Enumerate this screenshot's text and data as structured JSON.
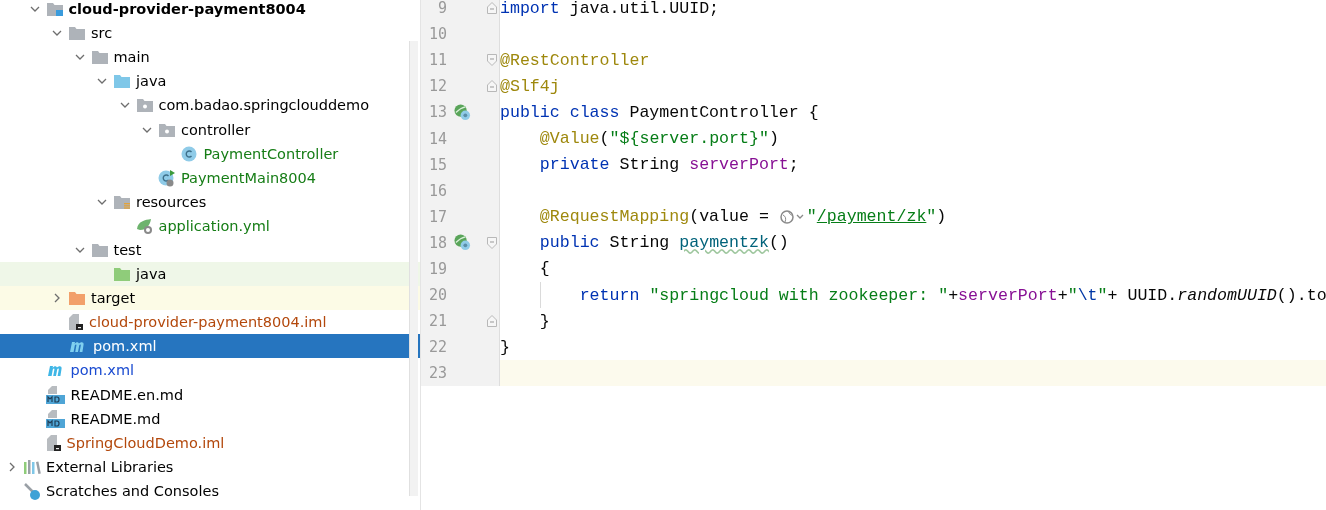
{
  "project_tree": [
    {
      "children": [
        {
          "label": "cloud-provider-payment8004",
          "kind": "module",
          "expanded": true,
          "selected": false,
          "bold": true,
          "children": [
            {
              "label": "src",
              "kind": "folder",
              "expanded": true,
              "selected": false,
              "children": [
                {
                  "label": "main",
                  "kind": "folder",
                  "expanded": true,
                  "selected": false,
                  "children": [
                    {
                      "label": "java",
                      "kind": "source-root",
                      "expanded": true,
                      "selected": false,
                      "children": [
                        {
                          "label": "com.badao.springclouddemo",
                          "kind": "package",
                          "expanded": true,
                          "selected": false,
                          "children": [
                            {
                              "label": "controller",
                              "kind": "package",
                              "expanded": true,
                              "selected": false,
                              "children": [
                                {
                                  "label": "PaymentController",
                                  "kind": "class",
                                  "selected": false,
                                  "color": "#167d16"
                                }
                              ]
                            },
                            {
                              "label": "PaymentMain8004",
                              "kind": "main-class",
                              "selected": false,
                              "color": "#167d16"
                            }
                          ]
                        }
                      ]
                    },
                    {
                      "label": "resources",
                      "kind": "resources",
                      "expanded": true,
                      "selected": false,
                      "children": [
                        {
                          "label": "application.yml",
                          "kind": "yaml",
                          "selected": false,
                          "color": "#167d16"
                        }
                      ]
                    }
                  ]
                },
                {
                  "label": "test",
                  "kind": "folder",
                  "expanded": true,
                  "selected": false,
                  "children": [
                    {
                      "label": "java",
                      "kind": "test-root",
                      "selected": false
                    }
                  ]
                }
              ]
            },
            {
              "label": "target",
              "kind": "excluded",
              "expanded": false,
              "selected": false
            },
            {
              "label": "cloud-provider-payment8004.iml",
              "kind": "iml",
              "selected": false,
              "color": "#b3480c"
            },
            {
              "label": "pom.xml",
              "kind": "maven",
              "selected": true
            }
          ]
        },
        {
          "label": "pom.xml",
          "kind": "maven",
          "selected": false,
          "color": "#1a4bd1"
        },
        {
          "label": "README.en.md",
          "kind": "markdown",
          "selected": false
        },
        {
          "label": "README.md",
          "kind": "markdown",
          "selected": false
        },
        {
          "label": "SpringCloudDemo.iml",
          "kind": "iml",
          "selected": false,
          "color": "#b3480c"
        }
      ]
    },
    {
      "label": "External Libraries",
      "kind": "libraries",
      "expanded": false,
      "selected": false
    },
    {
      "label": "Scratches and Consoles",
      "kind": "scratches",
      "selected": false
    }
  ],
  "editor": {
    "lines": [
      {
        "number": "9",
        "fold_end": true,
        "tokens": [
          {
            "kind": "kw",
            "t": "import"
          },
          {
            "kind": "plain",
            "t": " java.util.UUID;"
          }
        ]
      },
      {
        "number": "10"
      },
      {
        "number": "11",
        "fold_start": true,
        "tokens": [
          {
            "kind": "ann",
            "t": "@RestController"
          }
        ]
      },
      {
        "number": "12",
        "fold_end": true,
        "tokens": [
          {
            "kind": "ann",
            "t": "@Slf4j"
          }
        ]
      },
      {
        "number": "13",
        "bean_marker": true,
        "tokens": [
          {
            "kind": "kw",
            "t": "public class"
          },
          {
            "kind": "plain",
            "t": " PaymentController {"
          }
        ]
      },
      {
        "number": "14",
        "tokens": [
          {
            "kind": "ann",
            "t": "    @Value"
          },
          {
            "kind": "plain",
            "t": "("
          },
          {
            "kind": "str",
            "t": "\"${server.port}\""
          },
          {
            "kind": "plain",
            "t": ")"
          }
        ]
      },
      {
        "number": "15",
        "tokens": [
          {
            "kind": "kw",
            "t": "    private"
          },
          {
            "kind": "plain",
            "t": " String "
          },
          {
            "kind": "field",
            "t": "serverPort"
          },
          {
            "kind": "plain",
            "t": ";"
          }
        ]
      },
      {
        "number": "16"
      },
      {
        "number": "17",
        "tokens": [
          {
            "kind": "ann",
            "t": "    @RequestMapping"
          },
          {
            "kind": "plain",
            "t": "(value = "
          },
          {
            "kind": "inlay"
          },
          {
            "kind": "str",
            "t": "\""
          },
          {
            "kind": "link",
            "t": "/payment/zk"
          },
          {
            "kind": "str",
            "t": "\""
          },
          {
            "kind": "plain",
            "t": ")"
          }
        ]
      },
      {
        "number": "18",
        "bean_marker": true,
        "fold_start": true,
        "tokens": [
          {
            "kind": "kw",
            "t": "    public"
          },
          {
            "kind": "plain",
            "t": " String "
          },
          {
            "kind": "typo",
            "t": "paymentzk"
          },
          {
            "kind": "plain",
            "t": "()"
          }
        ]
      },
      {
        "number": "19",
        "tokens": [
          {
            "kind": "plain",
            "t": "    {"
          }
        ]
      },
      {
        "number": "20",
        "guide": true,
        "tokens": [
          {
            "kind": "kw",
            "t": "        return"
          },
          {
            "kind": "str",
            "t": " \"springcloud with zookeeper: \""
          },
          {
            "kind": "plain",
            "t": "+"
          },
          {
            "kind": "field",
            "t": "serverPort"
          },
          {
            "kind": "plain",
            "t": "+"
          },
          {
            "kind": "str",
            "t": "\""
          },
          {
            "kind": "esc",
            "t": "\\t"
          },
          {
            "kind": "str",
            "t": "\""
          },
          {
            "kind": "plain",
            "t": "+ UUID."
          },
          {
            "kind": "italic",
            "t": "randomUUID"
          },
          {
            "kind": "plain",
            "t": "().to"
          }
        ]
      },
      {
        "number": "21",
        "fold_end": true,
        "tokens": [
          {
            "kind": "plain",
            "t": "    }"
          }
        ]
      },
      {
        "number": "22",
        "tokens": [
          {
            "kind": "plain",
            "t": "}"
          }
        ]
      },
      {
        "number": "23",
        "current": true
      }
    ]
  }
}
